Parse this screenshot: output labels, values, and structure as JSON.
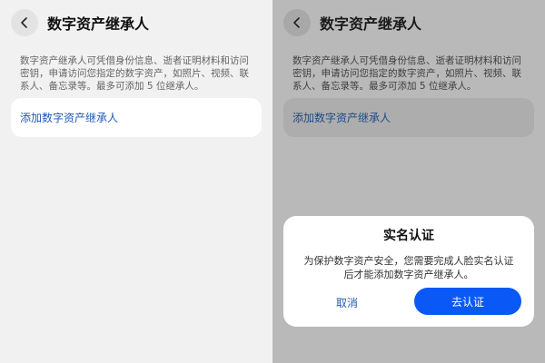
{
  "left": {
    "title": "数字资产继承人",
    "description": "数字资产继承人可凭借身份信息、逝者证明材料和访问密钥，申请访问您指定的数字资产，如照片、视频、联系人、备忘录等。最多可添加 5 位继承人。",
    "add_button_label": "添加数字资产继承人"
  },
  "right": {
    "title": "数字资产继承人",
    "description": "数字资产继承人可凭借身份信息、逝者证明材料和访问密钥，申请访问您指定的数字资产，如照片、视频、联系人、备忘录等。最多可添加 5 位继承人。",
    "add_button_label": "添加数字资产继承人",
    "dialog": {
      "title": "实名认证",
      "body": "为保护数字资产安全，您需要完成人脸实名认证后才能添加数字资产继承人。",
      "cancel_label": "取消",
      "confirm_label": "去认证"
    }
  },
  "icons": {
    "back": "chevron-left-icon"
  },
  "colors": {
    "accent": "#0a59f7",
    "link": "#1f5bb5",
    "scrim_background": "#b9b9b9"
  }
}
